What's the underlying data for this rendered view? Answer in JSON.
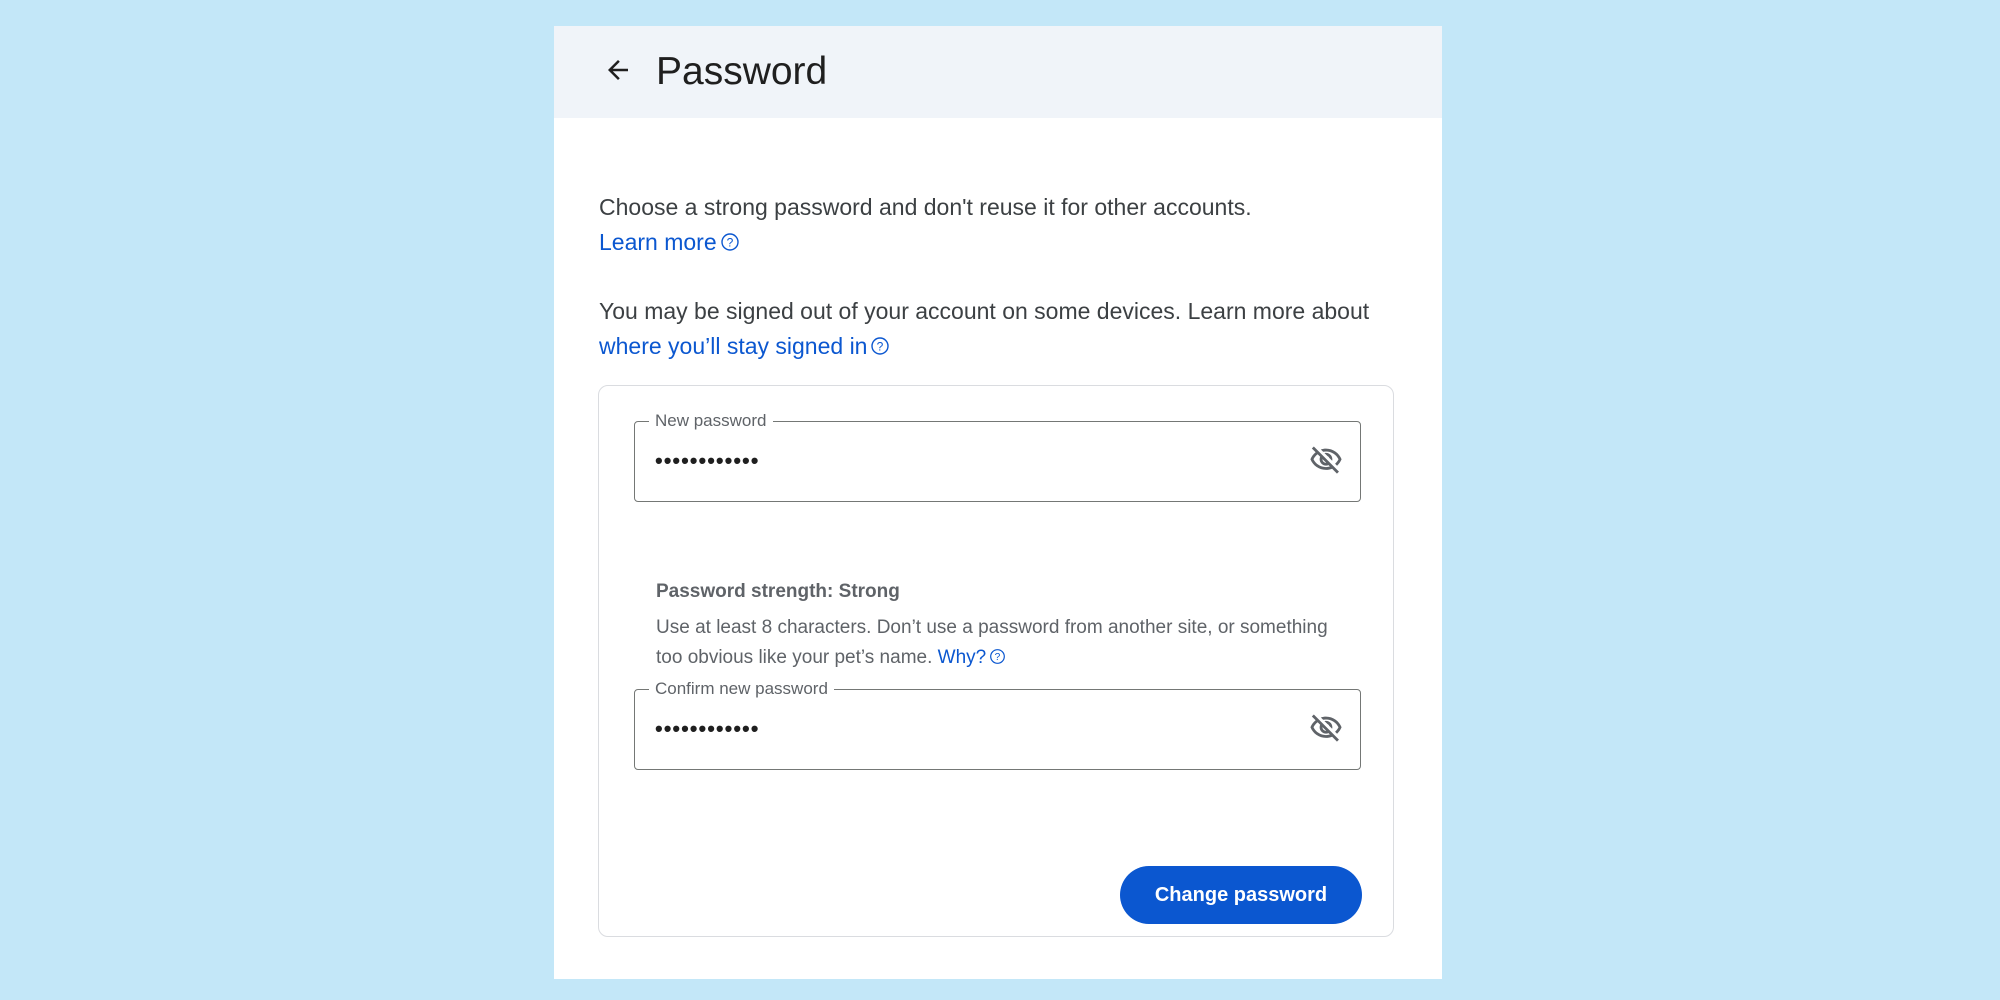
{
  "header": {
    "title": "Password",
    "back_icon": "arrow-back-icon"
  },
  "intro": {
    "text": "Choose a strong password and don't reuse it for other accounts.",
    "learn_more_link": "Learn more"
  },
  "signout_notice": {
    "text": "You may be signed out of your account on some devices. Learn more about",
    "link": "where you’ll stay signed in"
  },
  "form": {
    "new_password": {
      "label": "New password",
      "value": "••••••••••••",
      "toggle_icon": "visibility-off-icon"
    },
    "strength": {
      "title": "Password strength: Strong",
      "description": "Use at least 8 characters. Don’t use a password from another site, or something too obvious like your pet’s name.",
      "why_link": "Why?"
    },
    "confirm_password": {
      "label": "Confirm new password",
      "value": "••••••••••••",
      "toggle_icon": "visibility-off-icon"
    },
    "submit_label": "Change password"
  },
  "colors": {
    "background": "#c3e7f8",
    "header_bg": "#f0f4f9",
    "accent": "#0b57d0",
    "text": "#3c4043"
  }
}
